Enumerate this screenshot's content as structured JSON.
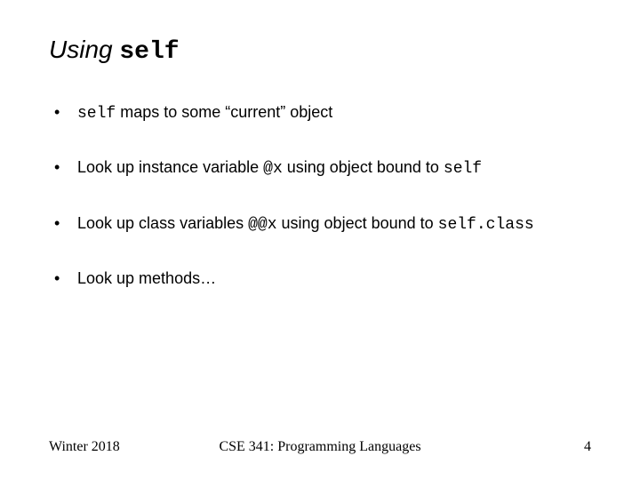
{
  "title": {
    "prefix": "Using ",
    "code": "self"
  },
  "bullets": [
    {
      "parts": [
        {
          "t": "code",
          "v": "self"
        },
        {
          "t": "text",
          "v": " maps to some “current” object"
        }
      ]
    },
    {
      "parts": [
        {
          "t": "text",
          "v": "Look up instance variable "
        },
        {
          "t": "code",
          "v": "@x"
        },
        {
          "t": "text",
          "v": " using object bound to "
        },
        {
          "t": "code",
          "v": "self"
        }
      ]
    },
    {
      "parts": [
        {
          "t": "text",
          "v": "Look up class variables "
        },
        {
          "t": "code",
          "v": "@@x"
        },
        {
          "t": "text",
          "v": " using object bound to "
        },
        {
          "t": "code",
          "v": "self.class"
        }
      ]
    },
    {
      "parts": [
        {
          "t": "text",
          "v": "Look up methods…"
        }
      ]
    }
  ],
  "footer": {
    "left": "Winter 2018",
    "center": "CSE 341: Programming Languages",
    "right": "4"
  }
}
